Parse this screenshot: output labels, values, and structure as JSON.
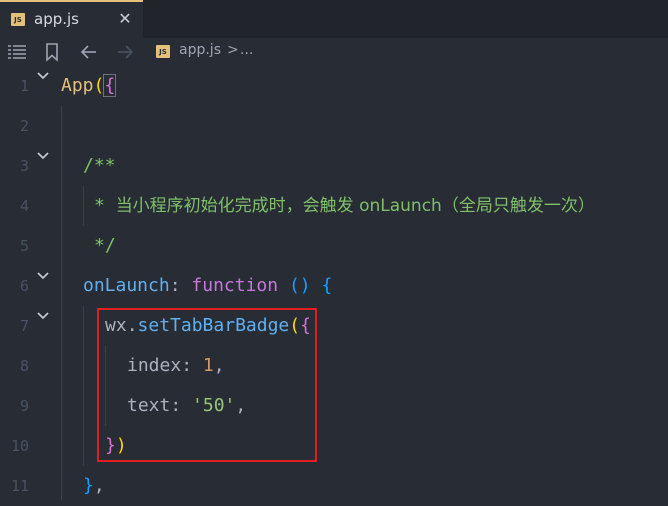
{
  "tab": {
    "badge": "JS",
    "filename": "app.js",
    "close_glyph": "✕"
  },
  "toolbar": {
    "icons": [
      "list-icon",
      "bookmark-icon",
      "back-arrow-icon",
      "forward-arrow-icon"
    ],
    "breadcrumb": {
      "badge": "JS",
      "file": "app.js",
      "separator": ">",
      "more": "..."
    }
  },
  "gutter": {
    "line_numbers": [
      "1",
      "2",
      "3",
      "4",
      "5",
      "6",
      "7",
      "8",
      "9",
      "10",
      "11"
    ]
  },
  "code": {
    "l1": {
      "fn": "App",
      "paren": "(",
      "brace": "{"
    },
    "l3": {
      "comment": "/**"
    },
    "l4": {
      "comment_prefix": "* ",
      "comment_text": "当小程序初始化完成时，会触发 onLaunch（全局只触发一次）"
    },
    "l5": {
      "comment": "*/"
    },
    "l6": {
      "prop": "onLaunch",
      "colon": ": ",
      "kw": "function",
      "space": " ",
      "parens": "()",
      "space2": " ",
      "brace": "{"
    },
    "l7": {
      "obj": "wx",
      "dot": ".",
      "method": "setTabBarBadge",
      "paren": "(",
      "brace": "{"
    },
    "l8": {
      "prop": "index",
      "colon": ": ",
      "num": "1",
      "comma": ","
    },
    "l9": {
      "prop": "text",
      "colon": ": ",
      "str": "'50'",
      "comma": ","
    },
    "l10": {
      "brace": "}",
      "paren": ")"
    },
    "l11": {
      "brace": "}",
      "comma": ","
    }
  },
  "colors": {
    "background": "#282c34",
    "tab_accent": "#e5c07b",
    "highlight_box": "#e02020"
  }
}
